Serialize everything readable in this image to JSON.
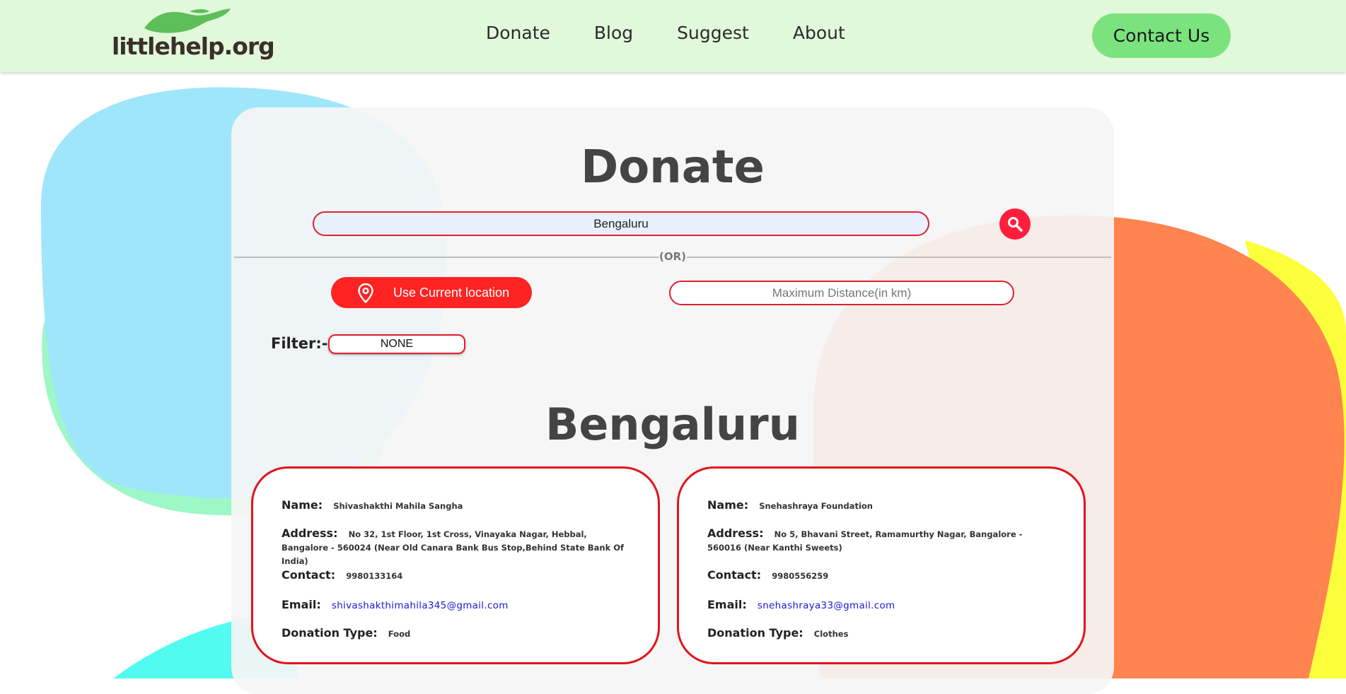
{
  "header": {
    "logo_text": "littlehelp.org",
    "nav": [
      "Donate",
      "Blog",
      "Suggest",
      "About"
    ],
    "contact_label": "Contact Us"
  },
  "donate": {
    "title": "Donate",
    "search_value": "Bengaluru",
    "or_text": "(OR)",
    "location_button": "Use Current location",
    "distance_placeholder": "Maximum Distance(in km)",
    "filter_label": "Filter:-",
    "filter_value": "NONE",
    "city_heading": "Bengaluru"
  },
  "labels": {
    "name": "Name:",
    "address": "Address:",
    "contact": "Contact:",
    "email": "Email:",
    "donation_type": "Donation Type:"
  },
  "organizations": [
    {
      "name": "Shivashakthi Mahila Sangha",
      "address": "No 32, 1st Floor, 1st Cross, Vinayaka Nagar, Hebbal, Bangalore - 560024 (Near Old Canara Bank Bus Stop,Behind State Bank Of India)",
      "contact": "9980133164",
      "email": "shivashakthimahila345@gmail.com",
      "donation_type": "Food"
    },
    {
      "name": "Snehashraya Foundation",
      "address": "No 5, Bhavani Street, Ramamurthy Nagar, Bangalore - 560016 (Near Kanthi Sweets)",
      "contact": "9980556259",
      "email": "snehashraya33@gmail.com",
      "donation_type": "Clothes"
    }
  ],
  "colors": {
    "header_bg": "#e1f8da",
    "accent_red": "#ff1f3d",
    "contact_green": "#7be37e",
    "blob_blue": "#9fe6fb",
    "blob_green": "#9ef7c6",
    "blob_cyan": "#52fbf0",
    "blob_orange": "#ff8450",
    "blob_yellow": "#fcff3c"
  },
  "icons": {
    "logo": "hand-icon",
    "search": "magnifier-icon",
    "location": "location-pin-icon"
  }
}
